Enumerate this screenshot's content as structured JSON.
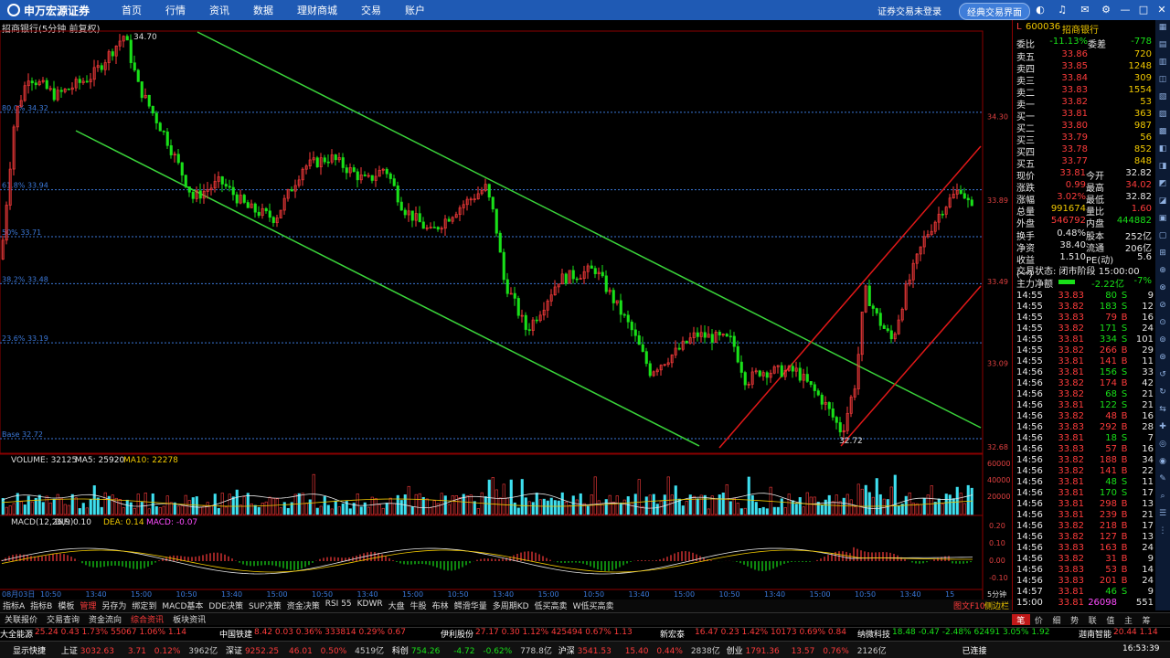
{
  "app": {
    "logo_text": "申万宏源证券",
    "nav": [
      "首页",
      "行情",
      "资讯",
      "数据",
      "理财商城",
      "交易",
      "账户"
    ],
    "login": "证券交易未登录",
    "classic": "经典交易界面"
  },
  "chart": {
    "title": "招商银行(5分钟 前复权)",
    "high_label": "34.70",
    "low_label": "32.72",
    "fib": [
      {
        "label": "80.0% 34.32",
        "price": 34.32
      },
      {
        "label": "61.8% 33.94",
        "price": 33.94
      },
      {
        "label": "50% 33.71",
        "price": 33.71
      },
      {
        "label": "38.2% 33.48",
        "price": 33.48
      },
      {
        "label": "23.6% 33.19",
        "price": 33.19
      },
      {
        "label": "Base 32.72",
        "price": 32.72
      }
    ],
    "right_axis": [
      "34.30",
      "33.89",
      "33.49",
      "33.09",
      "32.68"
    ],
    "date_label": "08月03日",
    "times": [
      "10:50",
      "13:40",
      "15:00",
      "10:50",
      "13:40",
      "15:00",
      "10:50",
      "13:40",
      "15:00",
      "10:50",
      "13:40",
      "15:00",
      "10:50",
      "13:40",
      "15:00",
      "10:50",
      "13:40",
      "15:00",
      "10:50",
      "13:40",
      "15"
    ],
    "volume_label": "VOLUME: 32125",
    "ma5_label": "MA5: 25920",
    "ma10_label": "MA10: 22278",
    "vol_axis": [
      "60000",
      "40000",
      "20000"
    ],
    "macd_label": "MACD(12,26,9)",
    "dif_label": "DIF: 0.10",
    "dea_label": "DEA: 0.14",
    "macd_val": "MACD: -0.07",
    "macd_axis": [
      "0.20",
      "0.10",
      "0.00",
      "-0.10"
    ],
    "period": "5分钟"
  },
  "quote": {
    "code": "600036",
    "name": "招商银行",
    "prefix": "L",
    "webi": {
      "k1": "委比",
      "v1": "-11.13%",
      "k2": "委差",
      "v2": "-778"
    },
    "sell": [
      {
        "k": "卖五",
        "p": "33.86",
        "v": "720"
      },
      {
        "k": "卖四",
        "p": "33.85",
        "v": "1248"
      },
      {
        "k": "卖三",
        "p": "33.84",
        "v": "309"
      },
      {
        "k": "卖二",
        "p": "33.83",
        "v": "1554"
      },
      {
        "k": "卖一",
        "p": "33.82",
        "v": "53"
      }
    ],
    "buy": [
      {
        "k": "买一",
        "p": "33.81",
        "v": "363"
      },
      {
        "k": "买二",
        "p": "33.80",
        "v": "987"
      },
      {
        "k": "买三",
        "p": "33.79",
        "v": "56"
      },
      {
        "k": "买四",
        "p": "33.78",
        "v": "852"
      },
      {
        "k": "买五",
        "p": "33.77",
        "v": "848"
      }
    ],
    "stats": [
      {
        "k1": "现价",
        "v1": "33.81",
        "c1": "red",
        "k2": "今开",
        "v2": "32.82",
        "c2": "wht"
      },
      {
        "k1": "涨跌",
        "v1": "0.99",
        "c1": "red",
        "k2": "最高",
        "v2": "34.02",
        "c2": "red"
      },
      {
        "k1": "涨幅",
        "v1": "3.02%",
        "c1": "red",
        "k2": "最低",
        "v2": "32.82",
        "c2": "wht"
      },
      {
        "k1": "总量",
        "v1": "991674",
        "c1": "yel",
        "k2": "量比",
        "v2": "1.60",
        "c2": "red"
      },
      {
        "k1": "外盘",
        "v1": "546792",
        "c1": "red",
        "k2": "内盘",
        "v2": "444882",
        "c2": "grn"
      },
      {
        "k1": "换手",
        "v1": "0.48%",
        "c1": "wht",
        "k2": "股本",
        "v2": "252亿",
        "c2": "wht"
      },
      {
        "k1": "净资",
        "v1": "38.40",
        "c1": "wht",
        "k2": "流通",
        "v2": "206亿",
        "c2": "wht"
      },
      {
        "k1": "收益(一)",
        "v1": "1.510",
        "c1": "wht",
        "k2": "PE(动)",
        "v2": "5.6",
        "c2": "wht"
      }
    ],
    "trade_status": "交易状态: 闭市阶段 15:00:00",
    "main_flow": {
      "k": "主力净额",
      "v": "-2.22亿",
      "p": "-7%"
    },
    "ticks": [
      [
        "14:55",
        "33.83",
        "80",
        "S",
        "9"
      ],
      [
        "14:55",
        "33.82",
        "183",
        "S",
        "12"
      ],
      [
        "14:55",
        "33.83",
        "79",
        "B",
        "16"
      ],
      [
        "14:55",
        "33.82",
        "171",
        "S",
        "24"
      ],
      [
        "14:55",
        "33.81",
        "334",
        "S",
        "101"
      ],
      [
        "14:55",
        "33.82",
        "266",
        "B",
        "29"
      ],
      [
        "14:55",
        "33.81",
        "141",
        "B",
        "11"
      ],
      [
        "14:56",
        "33.81",
        "156",
        "S",
        "33"
      ],
      [
        "14:56",
        "33.82",
        "174",
        "B",
        "42"
      ],
      [
        "14:56",
        "33.82",
        "68",
        "S",
        "21"
      ],
      [
        "14:56",
        "33.81",
        "122",
        "S",
        "21"
      ],
      [
        "14:56",
        "33.82",
        "48",
        "B",
        "16"
      ],
      [
        "14:56",
        "33.83",
        "292",
        "B",
        "28"
      ],
      [
        "14:56",
        "33.81",
        "18",
        "S",
        "7"
      ],
      [
        "14:56",
        "33.83",
        "57",
        "B",
        "16"
      ],
      [
        "14:56",
        "33.82",
        "188",
        "B",
        "34"
      ],
      [
        "14:56",
        "33.82",
        "141",
        "B",
        "22"
      ],
      [
        "14:56",
        "33.81",
        "48",
        "S",
        "11"
      ],
      [
        "14:56",
        "33.81",
        "170",
        "S",
        "17"
      ],
      [
        "14:56",
        "33.81",
        "298",
        "B",
        "13"
      ],
      [
        "14:56",
        "33.81",
        "239",
        "B",
        "21"
      ],
      [
        "14:56",
        "33.82",
        "218",
        "B",
        "17"
      ],
      [
        "14:56",
        "33.82",
        "127",
        "B",
        "13"
      ],
      [
        "14:56",
        "33.83",
        "163",
        "B",
        "24"
      ],
      [
        "14:56",
        "33.82",
        "31",
        "B",
        "9"
      ],
      [
        "14:56",
        "33.83",
        "53",
        "B",
        "14"
      ],
      [
        "14:56",
        "33.83",
        "201",
        "B",
        "24"
      ],
      [
        "14:57",
        "33.81",
        "46",
        "S",
        "9"
      ],
      [
        "15:00",
        "33.81",
        "26098",
        "",
        "551"
      ]
    ],
    "tabs": [
      "笔",
      "价",
      "细",
      "势",
      "联",
      "值",
      "主",
      "筹"
    ]
  },
  "tabs_row1": [
    "指标A",
    "指标B",
    "模板",
    "管理",
    "另存为",
    "绑定到",
    "MACD基本",
    "DDE决策",
    "SUP决策",
    "资金决策",
    "RSI 55",
    "KDWR",
    "大盘",
    "牛股",
    "布林",
    "鳄滑华量",
    "多周期KD",
    "低买高卖",
    "W低买高卖"
  ],
  "tabs_row2": [
    "关联报价",
    "交易查询",
    "资金流向",
    "综合资讯",
    "板块资讯"
  ],
  "right_tabs": [
    "图文F10",
    "侧边栏"
  ],
  "ticker": [
    {
      "n": "大全能源",
      "v": "25.24  0.43  1.73%  55067  1.06%  1.14"
    },
    {
      "n": "中国铁建",
      "v": "8.42  0.03  0.36%  333814  0.29%  0.67"
    },
    {
      "n": "伊利股份",
      "v": "27.17  0.30  1.12%  425494  0.67%  1.13"
    },
    {
      "n": "新宏泰",
      "v": "16.47  0.23  1.42%  10173  0.69%  0.84"
    },
    {
      "n": "纳微科技",
      "v": "18.48  -0.47  -2.48%  62491  3.05%  1.92"
    },
    {
      "n": "迦南智能",
      "v": "20.44  1.14"
    }
  ],
  "status": {
    "show": "显示快捷",
    "sh": "上证",
    "sh_v": "3032.63",
    "sh_c": "3.71",
    "sh_p": "0.12%",
    "sh_a": "3962亿",
    "sz": "深证",
    "sz_v": "9252.25",
    "sz_c": "46.01",
    "sz_p": "0.50%",
    "sz_a": "4519亿",
    "kc": "科创",
    "kc_v": "754.26",
    "kc_c": "-4.72",
    "kc_p": "-0.62%",
    "kc_a": "778.8亿",
    "hs": "沪深",
    "hs_v": "3541.53",
    "hs_c": "15.40",
    "hs_p": "0.44%",
    "hs_a": "2838亿",
    "cy": "创业",
    "cy_v": "1791.36",
    "cy_c": "13.57",
    "cy_p": "0.76%",
    "cy_a": "2126亿",
    "conn": "已连接",
    "time": "16:53:39"
  },
  "colors": {
    "up": "#ff3c3c",
    "down": "#19e019",
    "fib": "#3b78d8",
    "channel_green": "#3ad33a",
    "channel_red": "#e01818",
    "vol_up": "#ff3c3c",
    "vol_dn": "#3ee0f0"
  }
}
